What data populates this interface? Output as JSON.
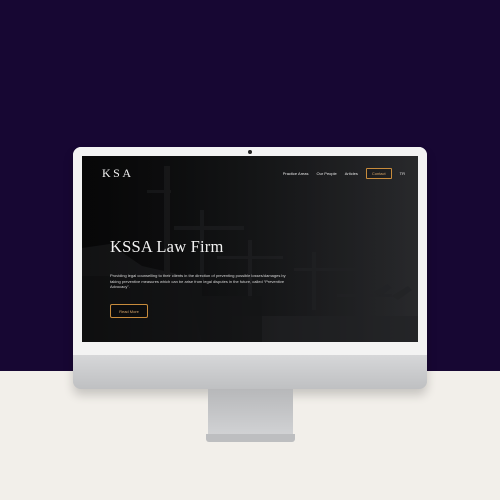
{
  "site": {
    "logo": "KSA",
    "nav": {
      "items": [
        {
          "label": "Practice Areas"
        },
        {
          "label": "Our People"
        },
        {
          "label": "Articles"
        }
      ],
      "contact_label": "Contact",
      "language_label": "TR"
    },
    "hero": {
      "title": "KSSA Law Firm",
      "description": "Providing legal counselling to their clients in the direction of preventing possible losses/damages by taking preventive measures which can be arise from legal disputes in the future, called “Preventive Advocacy”.",
      "cta_label": "Read More"
    }
  },
  "colors": {
    "background_top": "#170733",
    "background_bottom": "#f2efea",
    "accent": "#c78b3c"
  }
}
